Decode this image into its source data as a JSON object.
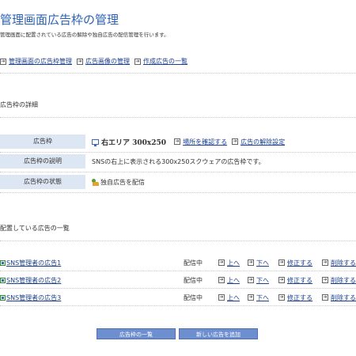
{
  "page": {
    "title": "管理画面広告枠の管理",
    "description": "管理画面に配置されている広告の解除や独自広告の配信管理を行います。"
  },
  "nav": {
    "items": [
      {
        "label": "管理画面の広告枠管理",
        "icon": "arrow-right-icon"
      },
      {
        "label": "広告画像の管理",
        "icon": "arrow-right-icon"
      },
      {
        "label": "作成広告の一覧",
        "icon": "arrow-right-icon"
      }
    ]
  },
  "details": {
    "heading": "広告枠の詳細",
    "rows": [
      {
        "label": "広告枠",
        "slot_name": "右エリア 300x250",
        "link1": "場所を確認する",
        "link2": "広告の解除設定"
      },
      {
        "label": "広告枠の説明",
        "value": "SNSの右上に表示される300x250スクウェアの広告枠です。"
      },
      {
        "label": "広告枠の状態",
        "value": "独自広告を配信"
      }
    ]
  },
  "ads": {
    "heading": "配置している広告の一覧",
    "rows": [
      {
        "name": "SNS管理者の広告1",
        "status": "配信中",
        "up": "上へ",
        "down": "下へ",
        "edit": "修正する",
        "delete": "削除する"
      },
      {
        "name": "SNS管理者の広告2",
        "status": "配信中",
        "up": "上へ",
        "down": "下へ",
        "edit": "修正する",
        "delete": "削除する"
      },
      {
        "name": "SNS管理者の広告3",
        "status": "配信中",
        "up": "上へ",
        "down": "下へ",
        "edit": "修正する",
        "delete": "削除する"
      }
    ]
  },
  "buttons": {
    "list_label": "広告枠の一覧",
    "add_label": "新しい広告を追加"
  },
  "colors": {
    "title": "#2a62b6",
    "link": "#1a3f8e",
    "label_bg": "#dde6f3",
    "button_bg": "#6e8fcf"
  }
}
